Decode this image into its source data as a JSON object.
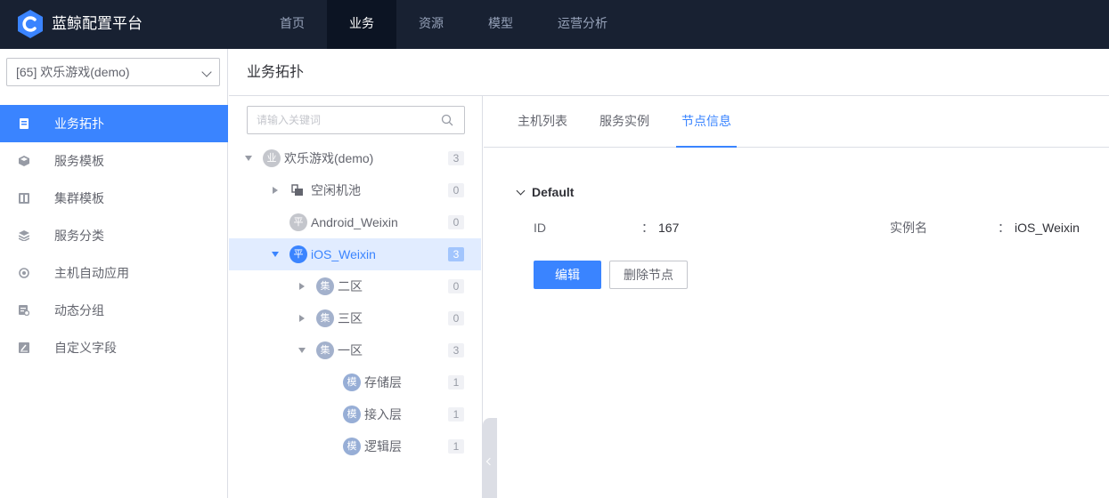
{
  "app": {
    "brand": "蓝鲸配置平台",
    "brand_color": "#3a84ff",
    "logo_icon": "cmdb-logo-icon"
  },
  "topnav": {
    "items": [
      {
        "label": "首页",
        "active": false
      },
      {
        "label": "业务",
        "active": true
      },
      {
        "label": "资源",
        "active": false
      },
      {
        "label": "模型",
        "active": false
      },
      {
        "label": "运营分析",
        "active": false
      }
    ]
  },
  "sidebar": {
    "business_select": "[65] 欢乐游戏(demo)",
    "items": [
      {
        "label": "业务拓扑",
        "icon": "topology-icon",
        "active": true
      },
      {
        "label": "服务模板",
        "icon": "cube-icon",
        "active": false
      },
      {
        "label": "集群模板",
        "icon": "cluster-icon",
        "active": false
      },
      {
        "label": "服务分类",
        "icon": "layers-icon",
        "active": false
      },
      {
        "label": "主机自动应用",
        "icon": "auto-apply-icon",
        "active": false
      },
      {
        "label": "动态分组",
        "icon": "dynamic-group-icon",
        "active": false
      },
      {
        "label": "自定义字段",
        "icon": "custom-field-icon",
        "active": false
      }
    ]
  },
  "page": {
    "title": "业务拓扑"
  },
  "tree": {
    "search_placeholder": "请输入关键词",
    "nodes": [
      {
        "name": "欢乐游戏(demo)",
        "badge": "业",
        "count": "3",
        "expanded": true
      },
      {
        "name": "空闲机池",
        "badge": "",
        "count": "0",
        "expanded": false
      },
      {
        "name": "Android_Weixin",
        "badge": "平",
        "count": "0",
        "expanded": false
      },
      {
        "name": "iOS_Weixin",
        "badge": "平",
        "count": "3",
        "expanded": true,
        "selected": true
      },
      {
        "name": "二区",
        "badge": "集",
        "count": "0",
        "expanded": false
      },
      {
        "name": "三区",
        "badge": "集",
        "count": "0",
        "expanded": false
      },
      {
        "name": "一区",
        "badge": "集",
        "count": "3",
        "expanded": true
      },
      {
        "name": "存储层",
        "badge": "模",
        "count": "1"
      },
      {
        "name": "接入层",
        "badge": "模",
        "count": "1"
      },
      {
        "name": "逻辑层",
        "badge": "模",
        "count": "1"
      }
    ]
  },
  "detail": {
    "tabs": [
      {
        "label": "主机列表",
        "active": false
      },
      {
        "label": "服务实例",
        "active": false
      },
      {
        "label": "节点信息",
        "active": true
      }
    ],
    "group_title": "Default",
    "fields": [
      {
        "label": "ID",
        "sep": "：",
        "value": "167"
      },
      {
        "label": "实例名",
        "sep": "：",
        "value": "iOS_Weixin"
      }
    ],
    "edit_button": "编辑",
    "delete_button": "删除节点"
  }
}
